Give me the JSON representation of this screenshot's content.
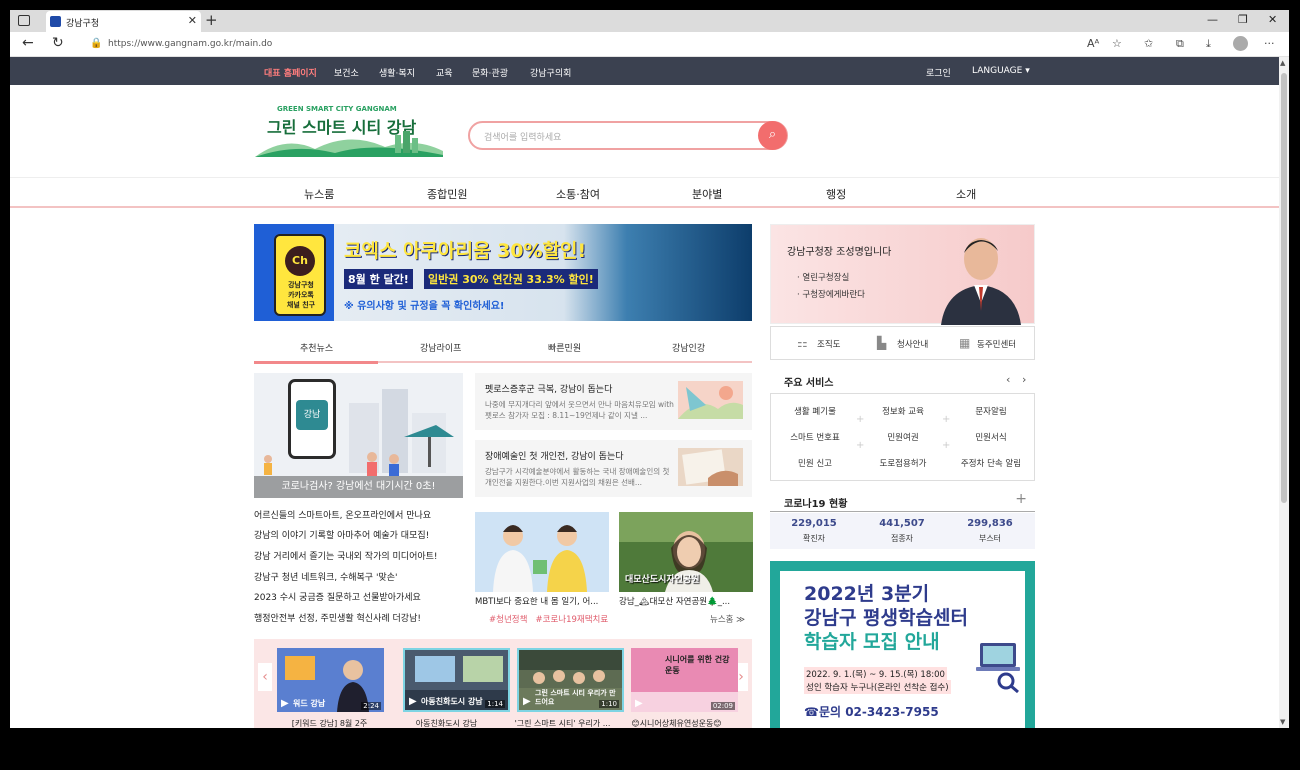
{
  "browser": {
    "tab_title": "강남구청",
    "url": "https://www.gangnam.go.kr/main.do"
  },
  "topbar": {
    "items": [
      "대표 홈페이지",
      "보건소",
      "생활·복지",
      "교육",
      "문화·관광",
      "강남구의회"
    ],
    "login": "로그인",
    "language": "LANGUAGE"
  },
  "logo": {
    "subtitle": "GREEN SMART CITY GANGNAM",
    "title": "그린 스마트 시티 강남"
  },
  "search": {
    "placeholder": "검색어를 입력하세요"
  },
  "mainnav": [
    "뉴스룸",
    "종합민원",
    "소통·참여",
    "분야별",
    "행정",
    "소개"
  ],
  "banner": {
    "app": "Ch",
    "app_text_1": "강남구청",
    "app_text_2": "카카오톡",
    "app_text_3": "채널 친구",
    "headline": "코엑스 아쿠아리움 30%할인!",
    "period": "8월 한 달간!",
    "detail": "일반권 30% 연간권 33.3% 할인!",
    "notice": "※ 유의사항 및 규정을 꼭 확인하세요!"
  },
  "mayor": {
    "title": "강남구청장 조성명입니다",
    "links": [
      "· 열린구청장실",
      "· 구청장에게바란다"
    ]
  },
  "quicklinks": [
    "조직도",
    "청사안내",
    "동주민센터"
  ],
  "newstabs": [
    "추천뉴스",
    "강남라이프",
    "빠른민원",
    "강남인강"
  ],
  "feature": {
    "screen": "강남",
    "caption": "코로나검사? 강남에선 대기시간 0초!"
  },
  "newsitems": [
    {
      "title": "펫로스증후군 극복, 강남이 돕는다",
      "desc": "나중에 무지개다리 앞에서 웃으면서 만나 마음치유모임 with 펫로스 참가자 모집 : 8.11~19언제나 같이 지낼 ..."
    },
    {
      "title": "장애예술인 첫 개인전, 강남이 돕는다",
      "desc": "강남구가 시각예술분야에서 활동하는 국내 장애예술인의 첫 개인전을 지원한다.이번 지원사업의 채원은 선배..."
    }
  ],
  "newslist": [
    "어르신들의 스마트아트, 온오프라인에서 만나요",
    "강남의 이야기 기록할 아마추어 예술가 대모집!",
    "강남 거리에서 즐기는 국내외 작가의 미디어아트!",
    "강남구 청년 네트워크, 수해복구 '맞손'",
    "2023 수시 궁금증 질문하고 선물받아가세요",
    "행정안전부 선정, 주민생활 혁신사례 더강남!"
  ],
  "thumbs": [
    {
      "caption": "MBTI보다 중요한 내 몸 일기, 어..."
    },
    {
      "caption": "강남_🏔대모산 자연공원🌲_...",
      "overlay": "대모산도시자연공원"
    }
  ],
  "tags": [
    "#청년정책",
    "#코로나19재택치료"
  ],
  "more_label": "뉴스홈 ≫",
  "videos": [
    {
      "caption": "[키워드 강남] 8월 2주",
      "duration": "2:24",
      "overlay": "워드 강남"
    },
    {
      "caption": "아동친화도시 강남",
      "duration": "1:14",
      "overlay": "아동친화도시 강남"
    },
    {
      "caption": "'그린 스마트 시티' 우리가 ...",
      "duration": "1:10",
      "overlay": "그린 스마트 시티 우리가 만드어요"
    },
    {
      "caption": "😊시니어상체유연성운동😊",
      "duration": "02:09",
      "overlay": "시니어를 위한 건강운동"
    }
  ],
  "services": {
    "title": "주요 서비스",
    "items": [
      "생활 폐기물",
      "정보화 교육",
      "문자알림",
      "스마트 번호표",
      "민원여권",
      "민원서식",
      "민원 신고",
      "도로점용허가",
      "주정차 단속 알림"
    ]
  },
  "covid": {
    "title": "코로나19 현황",
    "stats": [
      {
        "value": "229,015",
        "label": "확진자"
      },
      {
        "value": "441,507",
        "label": "접종자"
      },
      {
        "value": "299,836",
        "label": "부스터"
      }
    ]
  },
  "edu": {
    "line1": "2022년 3분기",
    "line2": "강남구 평생학습센터",
    "line3": "학습자 모집 안내",
    "date": "2022. 9. 1.(목) ~ 9. 15.(목) 18:00",
    "target": "성인 학습자 누구나(온라인 선착순 접수)",
    "contact": "☎문의 02-3423-7955"
  },
  "colors": {
    "topbar": "#3b4150",
    "accent": "#f26d6d",
    "covid_number": "#3d4a8b"
  }
}
